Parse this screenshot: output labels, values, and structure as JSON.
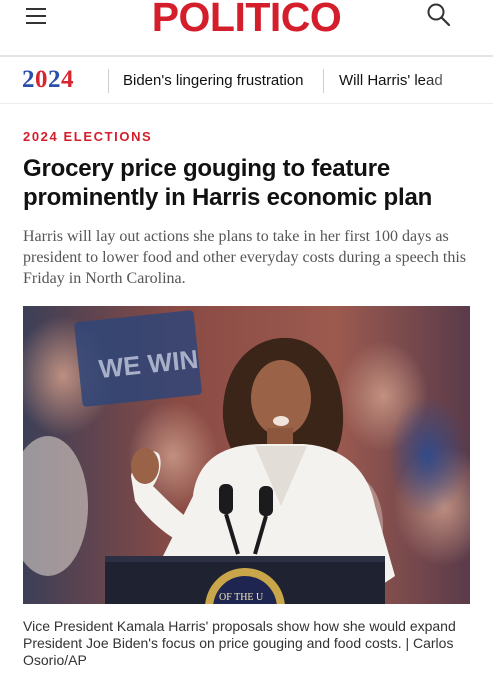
{
  "header": {
    "logo_text": "POLITICO",
    "menu_icon": "hamburger-menu-icon",
    "search_icon": "search-icon",
    "brand_color": "#d41e2c"
  },
  "subnav": {
    "section_digits": [
      "2",
      "0",
      "2",
      "4"
    ],
    "section_colors": {
      "blue": "#2a4fa8",
      "red": "#d7262f"
    },
    "links": [
      "Biden's lingering frustration",
      "Will Harris' lead"
    ]
  },
  "article": {
    "kicker": "2024 ELECTIONS",
    "headline": "Grocery price gouging to feature prominently in Harris economic plan",
    "dek": "Harris will lay out actions she plans to take in her first 100 days as president to lower food and other everyday costs during a speech this Friday in North Carolina.",
    "image": {
      "description_icon": "photo-kamala-harris-speaking-at-podium",
      "sign_text": "WE WIN",
      "seal_text": "OF THE U"
    },
    "caption": "Vice President Kamala Harris' proposals show how she would expand President Joe Biden's focus on price gouging and food costs. | Carlos Osorio/AP"
  }
}
